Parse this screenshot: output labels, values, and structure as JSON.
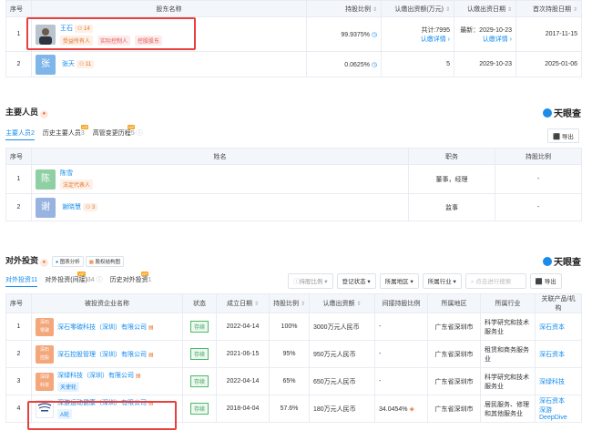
{
  "shareholders": {
    "headers": [
      "序号",
      "股东名称",
      "持股比例",
      "认缴出资额(万元)",
      "认缴出资日期",
      "首次持股日期"
    ],
    "rows": [
      {
        "index": "1",
        "avatar": "",
        "name": "王石",
        "count": "14",
        "tags": [
          "受益所有人",
          "实际控制人",
          "控股股东"
        ],
        "ratio": "99.9375%",
        "amount_line1": "共计:7995",
        "amount_line2": "认缴详情",
        "date_line1": "最新：2029-10-23",
        "date_line2": "认缴详情",
        "first": "2017-11-15"
      },
      {
        "index": "2",
        "avatar": "张",
        "name": "张天",
        "count": "11",
        "tags": [],
        "ratio": "0.0625%",
        "amount_line1": "5",
        "amount_line2": "",
        "date_line1": "2029-10-23",
        "date_line2": "",
        "first": "2025-01-06"
      }
    ]
  },
  "key_people": {
    "title": "主要人员",
    "badge": "●",
    "logo": "天眼查",
    "tabs": [
      {
        "label": "主要人员",
        "count": "2"
      },
      {
        "label": "历史主要人员",
        "count": "3"
      },
      {
        "label": "高管变更历程",
        "count": "5"
      }
    ],
    "export": "导出",
    "headers": [
      "序号",
      "姓名",
      "职务",
      "持股比例"
    ],
    "rows": [
      {
        "index": "1",
        "avatar": "陈",
        "name": "陈雪",
        "tag": "法定代表人",
        "count": "",
        "role": "董事，经理",
        "ratio": "-"
      },
      {
        "index": "2",
        "avatar": "谢",
        "name": "谢晓慧",
        "tag": "",
        "count": "3",
        "role": "监事",
        "ratio": "-"
      }
    ]
  },
  "investment": {
    "title": "对外投资",
    "badge": "●",
    "chart_btn": "图表分析",
    "struct_btn": "股权结构图",
    "logo": "天眼查",
    "tabs": [
      {
        "label": "对外投资",
        "count": "11"
      },
      {
        "label": "对外投资(间接)",
        "count": "34"
      },
      {
        "label": "历史对外投资",
        "count": "1"
      }
    ],
    "filters": [
      "持股比例",
      "登记状态",
      "所属地区",
      "所属行业"
    ],
    "search_placeholder": "点击进行搜索",
    "export": "导出",
    "headers": [
      "序号",
      "被投资企业名称",
      "状态",
      "成立日期",
      "持股比例",
      "认缴出资额",
      "间接持股比例",
      "所属地区",
      "所属行业",
      "关联产品/机构"
    ],
    "rows": [
      {
        "index": "1",
        "logo": "深石\n零碳",
        "logo_color": "#f3a77b",
        "name": "深石零碳科技（深圳）有限公司",
        "tag": "",
        "status": "存续",
        "date": "2022-04-14",
        "ratio": "100%",
        "amount": "3000万元人民币",
        "indirect": "-",
        "region": "广东省深圳市",
        "industry": "科学研究和技术服务业",
        "product": "深石资本"
      },
      {
        "index": "2",
        "logo": "深石\n控股",
        "logo_color": "#f3a77b",
        "name": "深石控股管理（深圳）有限公司",
        "tag": "",
        "status": "存续",
        "date": "2021-06-15",
        "ratio": "95%",
        "amount": "950万元人民币",
        "indirect": "-",
        "region": "广东省深圳市",
        "industry": "租赁和商务服务业",
        "product": "深石资本"
      },
      {
        "index": "3",
        "logo": "深绿\n科技",
        "logo_color": "#f3a77b",
        "name": "深绿科技（深圳）有限公司",
        "tag": "天使轮",
        "status": "存续",
        "date": "2022-04-14",
        "ratio": "65%",
        "amount": "650万元人民币",
        "indirect": "-",
        "region": "广东省深圳市",
        "industry": "科学研究和技术服务业",
        "product": "深绿科技"
      },
      {
        "index": "4",
        "logo": "",
        "logo_color": "#ffffff",
        "name": "深游运动健康（深圳）有限公司",
        "tag": "A轮",
        "status": "存续",
        "date": "2018-04-04",
        "ratio": "57.6%",
        "amount": "180万元人民币",
        "indirect": "34.0454%",
        "region": "广东省深圳市",
        "industry": "居民服务、修理和其他服务业",
        "product": "深石资本\n深游DeepDive"
      }
    ]
  }
}
